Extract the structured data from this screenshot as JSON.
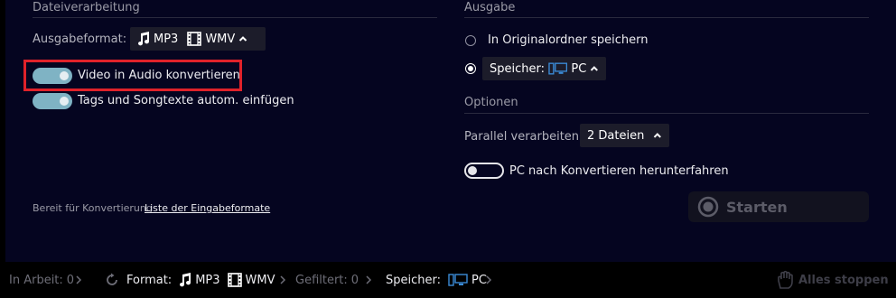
{
  "left": {
    "title": "Dateiverarbeitung",
    "format_label": "Ausgabeformat:",
    "format_audio": "MP3",
    "format_video": "WMV",
    "toggle1_label": "Video in Audio konvertieren",
    "toggle1_on": true,
    "toggle2_label": "Tags und Songtexte autom. einfügen",
    "toggle2_on": true,
    "ready_text": "Bereit für Konvertierung",
    "input_formats_link": "Liste der Eingabeformate"
  },
  "right": {
    "title": "Ausgabe",
    "radio1_label": "In Originalordner speichern",
    "radio1_checked": false,
    "radio2_label": "Speicher:",
    "radio2_value": "PC",
    "radio2_checked": true,
    "options_title": "Optionen",
    "parallel_label": "Parallel verarbeiten:",
    "parallel_value": "2 Dateien",
    "shutdown_label": "PC nach Konvertieren herunterfahren",
    "shutdown_on": false,
    "start_label": "Starten"
  },
  "status": {
    "in_work_label": "In Arbeit:",
    "in_work_value": "0",
    "format_label": "Format:",
    "format_audio": "MP3",
    "format_video": "WMV",
    "filtered_label": "Gefiltert:",
    "filtered_value": "0",
    "storage_label": "Speicher:",
    "storage_value": "PC",
    "stop_all_label": "Alles stoppen"
  },
  "colors": {
    "panel_bg": "#050520",
    "highlight": "#e0222a",
    "toggle_on": "#7fb3c4",
    "accent_blue": "#3b8bd6"
  }
}
